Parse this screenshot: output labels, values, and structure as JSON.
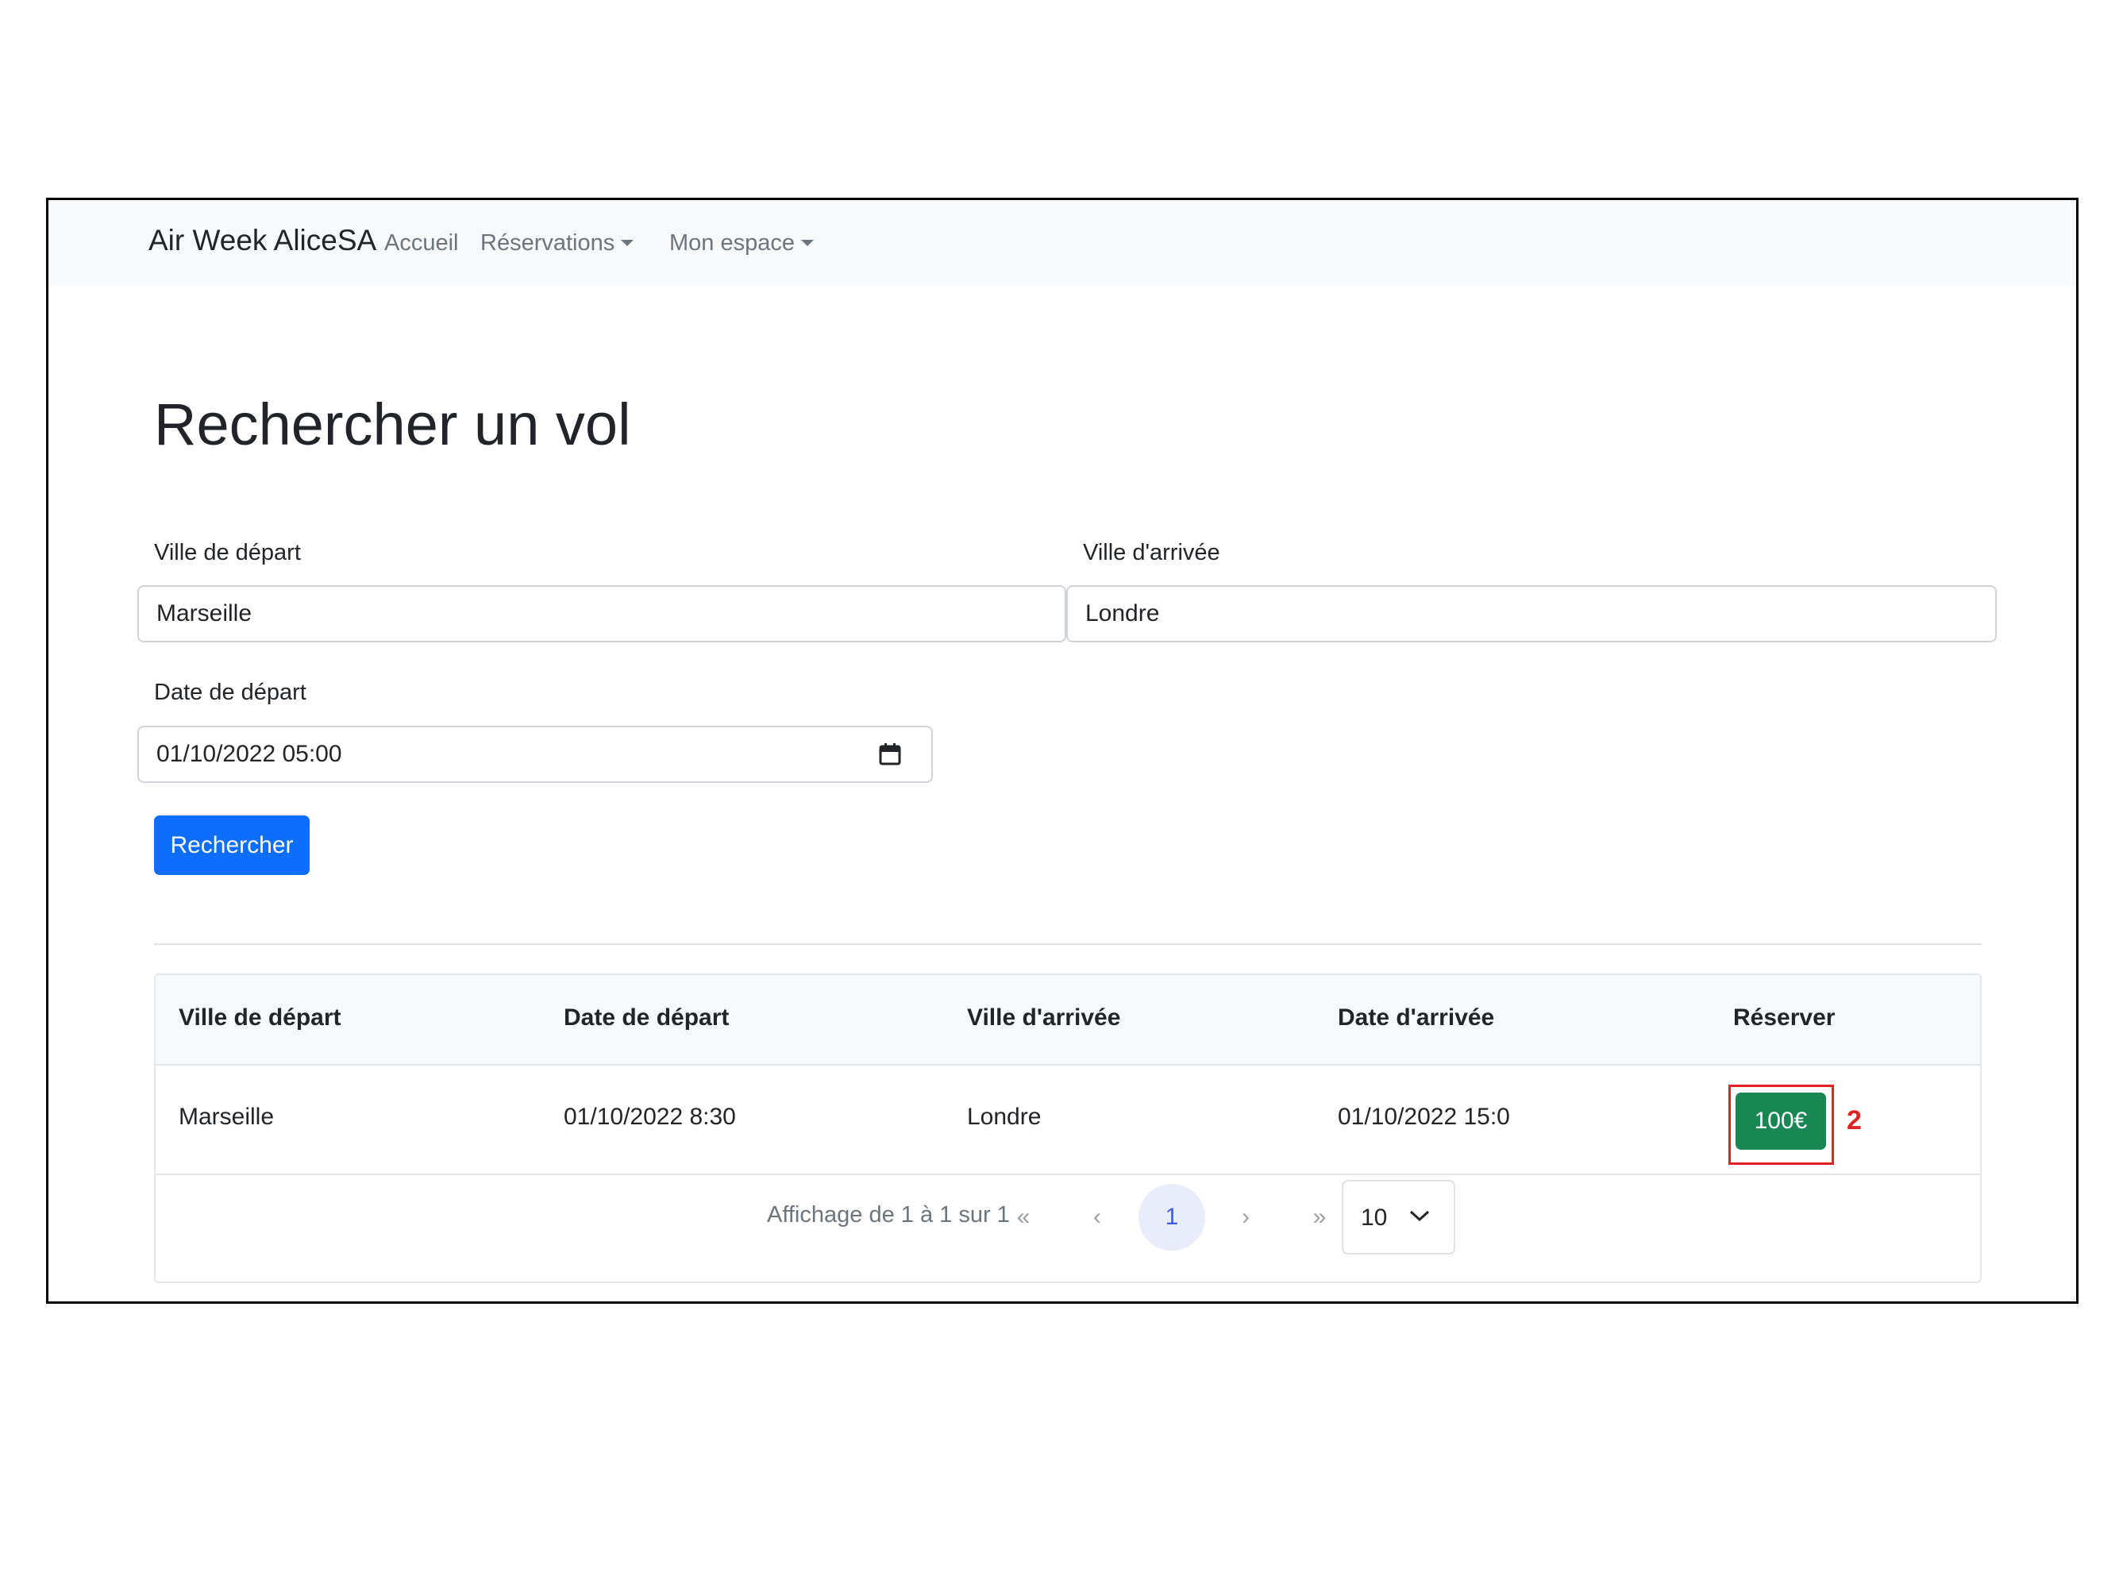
{
  "navbar": {
    "brand": "Air Week AliceSA",
    "links": [
      {
        "label": "Accueil"
      },
      {
        "label": "Réservations"
      },
      {
        "label": "Mon espace"
      }
    ]
  },
  "page": {
    "title": "Rechercher un vol"
  },
  "form": {
    "departure_city_label": "Ville de départ",
    "departure_city_value": "Marseille",
    "arrival_city_label": "Ville d'arrivée",
    "arrival_city_value": "Londre",
    "departure_date_label": "Date de départ",
    "departure_date_value": "01/10/2022 05:00",
    "search_button": "Rechercher"
  },
  "table": {
    "headers": [
      "Ville de départ",
      "Date de départ",
      "Ville d'arrivée",
      "Date d'arrivée",
      "Réserver"
    ],
    "rows": [
      {
        "departure_city": "Marseille",
        "departure_date": "01/10/2022 8:30",
        "arrival_city": "Londre",
        "arrival_date": "01/10/2022 15:0",
        "price": "100€"
      }
    ]
  },
  "annotation": "2",
  "pagination": {
    "info": "Affichage de 1 à 1 sur 1",
    "first": "«",
    "prev": "‹",
    "current_page": "1",
    "next": "›",
    "last": "»",
    "page_size": "10"
  },
  "icons": {
    "date": "calendar-icon",
    "page_size": "chevron-down-icon"
  },
  "colors": {
    "primary": "#0d6efd",
    "success": "#198754",
    "highlight": "#e02424",
    "navbar_bg": "#f8f9fa"
  }
}
